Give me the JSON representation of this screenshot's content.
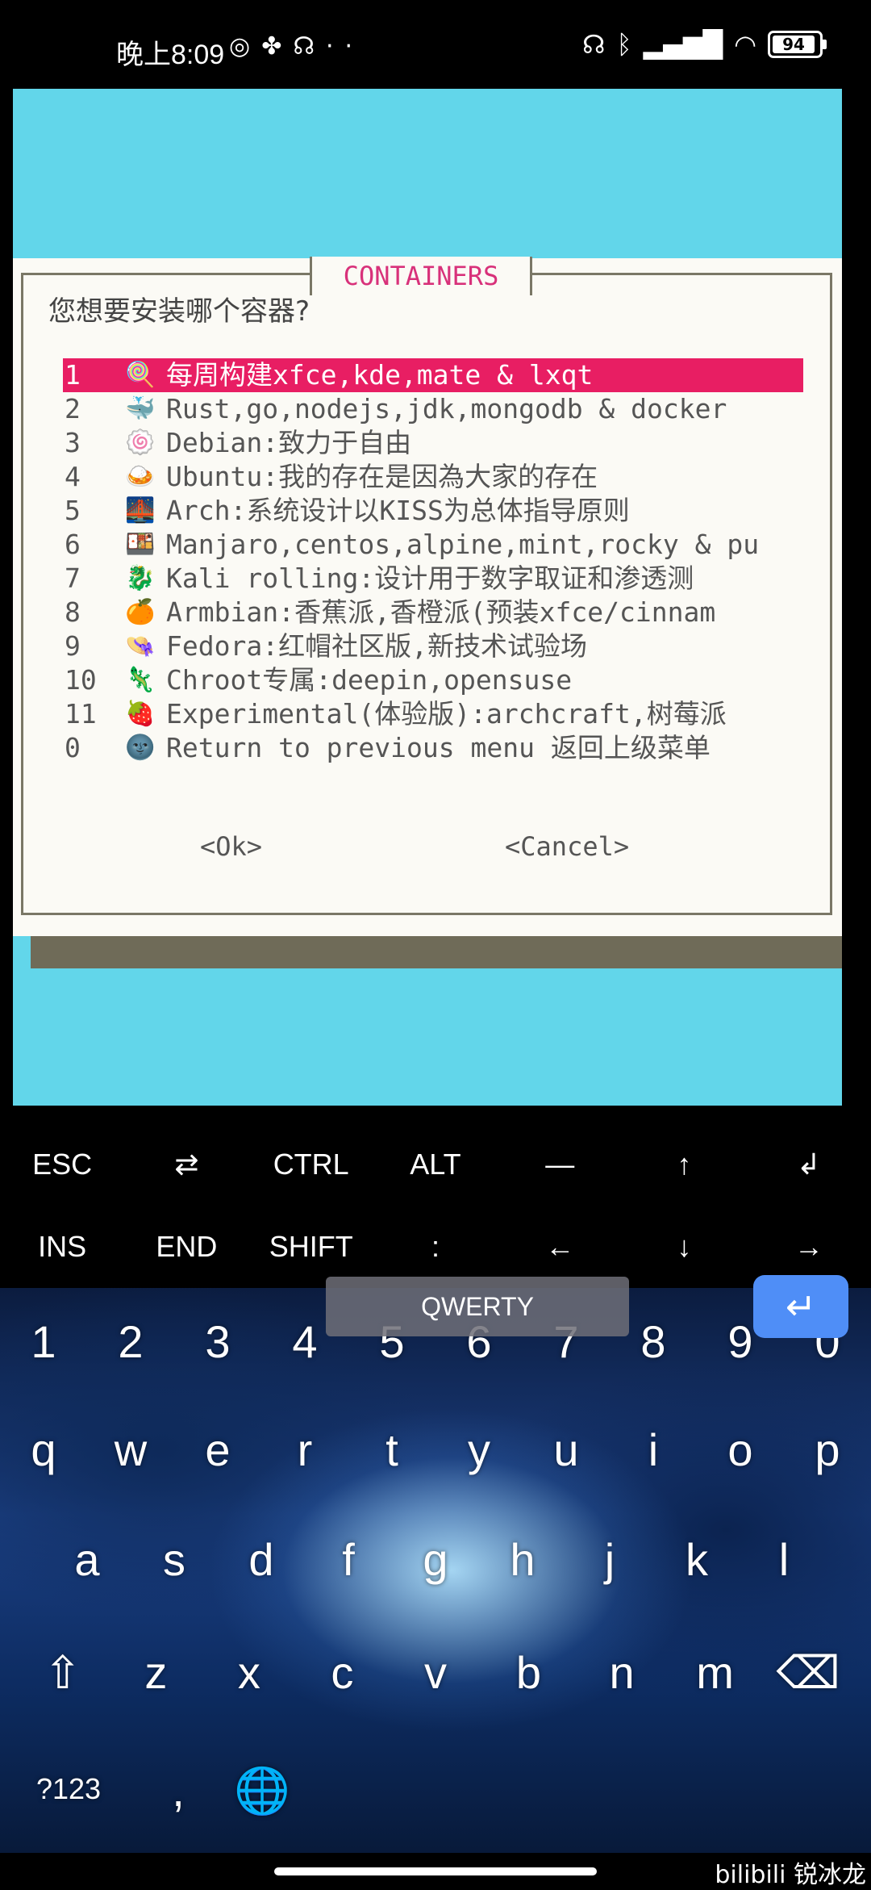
{
  "status_bar": {
    "time": "晚上8:09",
    "battery": "94",
    "icons_left": [
      "swirl-icon",
      "maple-leaf-icon",
      "headphones-icon",
      "more-dots-icon"
    ],
    "icons_right": [
      "headset-icon",
      "bluetooth-icon",
      "signal-hd-icon",
      "wifi-icon",
      "battery-icon"
    ]
  },
  "dialog": {
    "title": "CONTAINERS",
    "prompt": "您想要安装哪个容器?",
    "items": [
      {
        "num": "1",
        "icon": "🍭",
        "label": "每周构建xfce,kde,mate & lxqt",
        "selected": true
      },
      {
        "num": "2",
        "icon": "🐳",
        "label": "Rust,go,nodejs,jdk,mongodb & docker"
      },
      {
        "num": "3",
        "icon": "🍥",
        "label": "Debian:致力于自由"
      },
      {
        "num": "4",
        "icon": "🍛",
        "label": "Ubuntu:我的存在是因為大家的存在"
      },
      {
        "num": "5",
        "icon": "🌉",
        "label": "Arch:系统设计以KISS为总体指导原则"
      },
      {
        "num": "6",
        "icon": "🍱",
        "label": "Manjaro,centos,alpine,mint,rocky & pu"
      },
      {
        "num": "7",
        "icon": "🐉",
        "label": "Kali rolling:设计用于数字取证和渗透测"
      },
      {
        "num": "8",
        "icon": "🍊",
        "label": "Armbian:香蕉派,香橙派(预装xfce/cinnam"
      },
      {
        "num": "9",
        "icon": "👒",
        "label": "Fedora:红帽社区版,新技术试验场"
      },
      {
        "num": "10",
        "icon": "🦎",
        "label": "Chroot专属:deepin,opensuse"
      },
      {
        "num": "11",
        "icon": "🍓",
        "label": "Experimental(体验版):archcraft,树莓派"
      },
      {
        "num": "0",
        "icon": "🌚",
        "label": "Return to previous menu 返回上级菜单"
      }
    ],
    "ok": "<Ok>",
    "cancel": "<Cancel>"
  },
  "extra_keys": {
    "row1": [
      "ESC",
      "⇄",
      "CTRL",
      "ALT",
      "—",
      "↑",
      "↲"
    ],
    "row2": [
      "INS",
      "END",
      "SHIFT",
      ":",
      "←",
      "↓",
      "→"
    ]
  },
  "keyboard": {
    "numbers": [
      "1",
      "2",
      "3",
      "4",
      "5",
      "6",
      "7",
      "8",
      "9",
      "0"
    ],
    "row1": [
      "q",
      "w",
      "e",
      "r",
      "t",
      "y",
      "u",
      "i",
      "o",
      "p"
    ],
    "row2": [
      "a",
      "s",
      "d",
      "f",
      "g",
      "h",
      "j",
      "k",
      "l"
    ],
    "row3": [
      "z",
      "x",
      "c",
      "v",
      "b",
      "n",
      "m"
    ],
    "symbols_key": "?123",
    "comma_key": ",",
    "space_label": "QWERTY"
  },
  "watermark": "bilibili 锐冰龙"
}
